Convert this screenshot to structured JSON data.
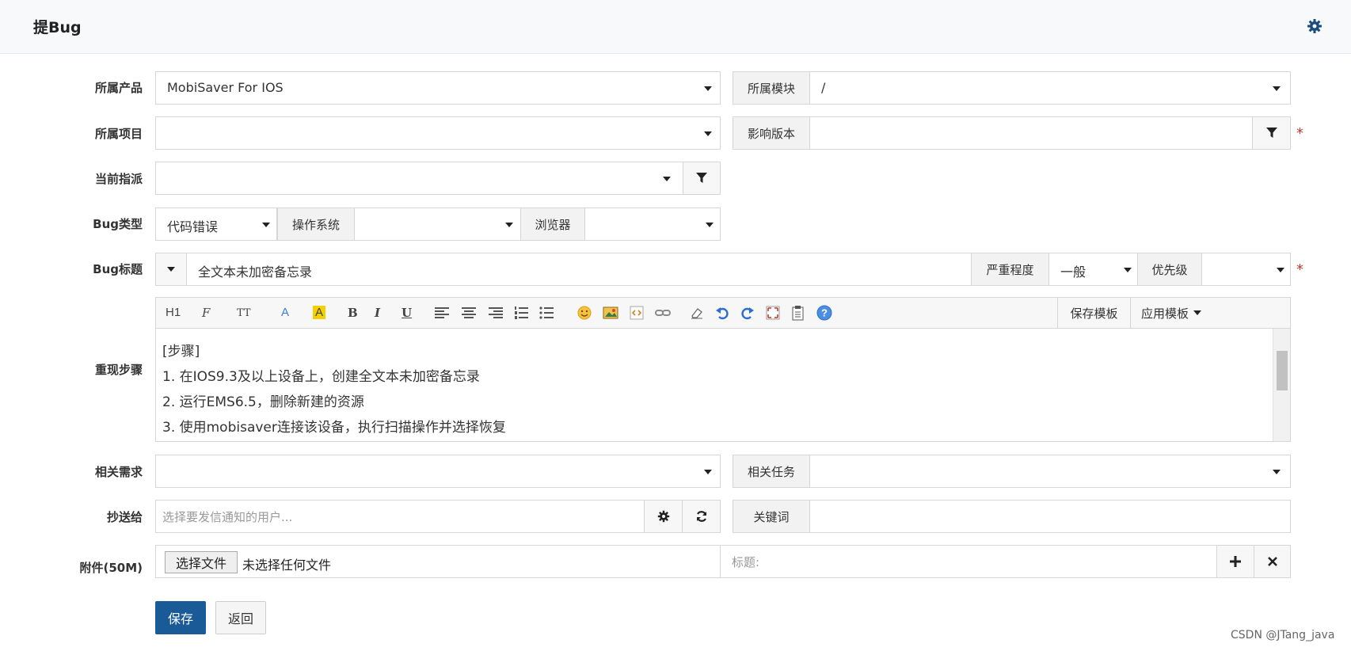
{
  "header": {
    "title": "提Bug",
    "settings_icon": "gear-icon"
  },
  "labels": {
    "product": "所属产品",
    "project": "所属项目",
    "assign": "当前指派",
    "bug_type": "Bug类型",
    "bug_title": "Bug标题",
    "steps": "重现步骤",
    "story": "相关需求",
    "mailto": "抄送给",
    "files": "附件(50M)"
  },
  "fields": {
    "product_value": "MobiSaver For IOS",
    "module_label": "所属模块",
    "module_value": "/",
    "build_label": "影响版本",
    "type_value": "代码错误",
    "os_label": "操作系统",
    "browser_label": "浏览器",
    "title_value": "全文本未加密备忘录",
    "severity_label": "严重程度",
    "severity_value": "一般",
    "priority_label": "优先级",
    "task_label": "相关任务",
    "mailto_placeholder": "选择要发信通知的用户...",
    "keywords_label": "关键词",
    "file_button": "选择文件",
    "file_status": "未选择任何文件",
    "file_title_placeholder": "标题:"
  },
  "editor": {
    "toolbar": {
      "heading": "H1",
      "font_family": "F",
      "font_size": "TT",
      "font_color": "A",
      "bg_color": "A",
      "bold": "B",
      "italic": "I",
      "underline": "U",
      "save_template": "保存模板",
      "apply_template": "应用模板"
    },
    "lines": [
      "[步骤]",
      "1. 在IOS9.3及以上设备上，创建全文本未加密备忘录",
      "2. 运行EMS6.5，删除新建的资源",
      "3. 使用mobisaver连接该设备，执行扫描操作并选择恢复"
    ]
  },
  "actions": {
    "save": "保存",
    "back": "返回"
  },
  "required_mark": "*",
  "watermark": "CSDN @JTang_java",
  "colors": {
    "primary": "#1a5a96",
    "required": "#c0392b"
  }
}
